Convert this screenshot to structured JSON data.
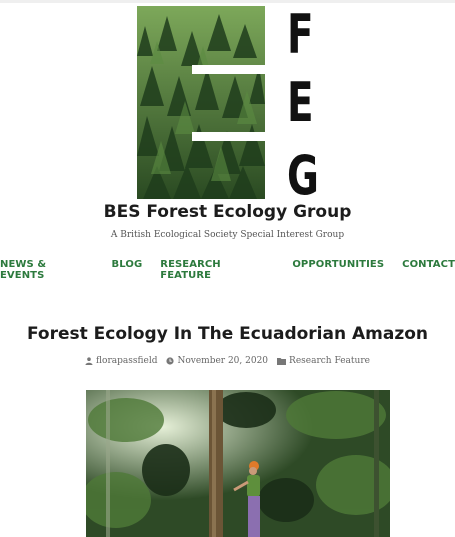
{
  "site": {
    "logo_letters": [
      "F",
      "E",
      "G"
    ],
    "title": "BES Forest Ecology Group",
    "tagline": "A British Ecological Society Special Interest Group"
  },
  "nav": {
    "items": [
      {
        "label": "NEWS & EVENTS"
      },
      {
        "label": "BLOG"
      },
      {
        "label": "RESEARCH FEATURE"
      },
      {
        "label": "OPPORTUNITIES"
      },
      {
        "label": "CONTACT"
      }
    ]
  },
  "post": {
    "title": "Forest Ecology In The Ecuadorian Amazon",
    "author": "florapassfield",
    "date": "November 20, 2020",
    "category": "Research Feature"
  },
  "colors": {
    "accent": "#2c7a3d",
    "text": "#1c1c1c",
    "meta": "#666666"
  },
  "icons": {
    "author": "person-icon",
    "date": "clock-icon",
    "category": "folder-icon"
  }
}
